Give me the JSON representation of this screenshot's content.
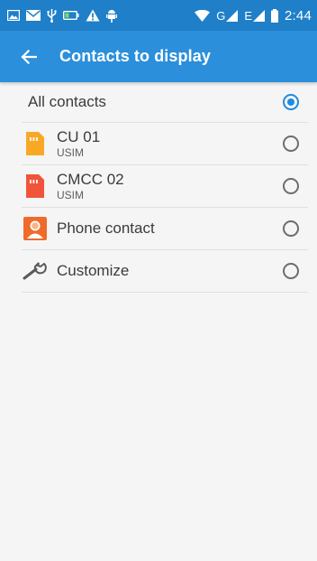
{
  "status_bar": {
    "time": "2:44",
    "network_g": "G",
    "network_e": "E",
    "icons_left": [
      "image-icon",
      "mail-icon",
      "usb-icon",
      "battery-saver-icon",
      "warning-icon",
      "android-debug-icon"
    ],
    "icons_right": [
      "wifi-icon",
      "signal-icon",
      "signal-icon",
      "battery-icon"
    ]
  },
  "app_bar": {
    "title": "Contacts to display",
    "back_icon": "arrow-left-icon"
  },
  "options": [
    {
      "label": "All contacts",
      "sub": "",
      "icon": "",
      "selected": true
    },
    {
      "label": "CU 01",
      "sub": "USIM",
      "icon": "sim-card-icon",
      "icon_color": "#f9a825",
      "selected": false
    },
    {
      "label": "CMCC 02",
      "sub": "USIM",
      "icon": "sim-card-icon",
      "icon_color": "#f0543a",
      "selected": false
    },
    {
      "label": "Phone contact",
      "sub": "",
      "icon": "phone-contact-icon",
      "icon_color": "#f06a2a",
      "selected": false
    },
    {
      "label": "Customize",
      "sub": "",
      "icon": "wrench-icon",
      "selected": false
    }
  ],
  "colors": {
    "status_bar": "#1f7fc8",
    "app_bar": "#2b8fdc",
    "accent": "#1f8be0",
    "background": "#f5f5f5"
  }
}
